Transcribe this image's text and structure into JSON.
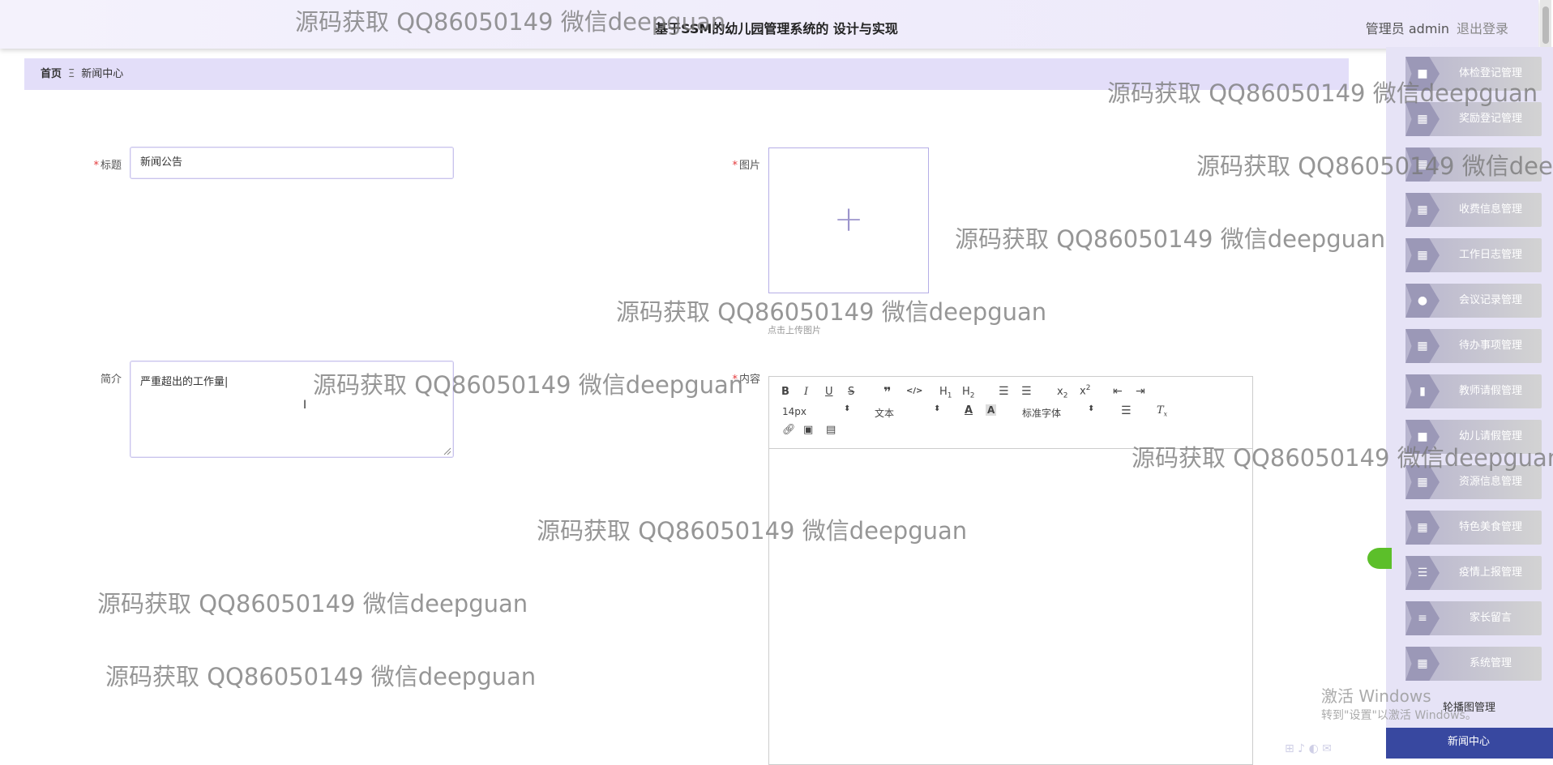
{
  "header": {
    "title": "基于SSM的幼儿园管理系统的 设计与实现",
    "user_label": "管理员 admin",
    "logout_label": "退出登录"
  },
  "breadcrumb": {
    "home": "首页",
    "separator": "Ξ",
    "current": "新闻中心"
  },
  "form": {
    "title_label": "标题",
    "title_value": "新闻公告",
    "image_label": "图片",
    "upload_hint": "点击上传图片",
    "summary_label": "简介",
    "summary_value": "严重超出的工作量|",
    "content_label": "内容"
  },
  "editor": {
    "font_size": "14px",
    "paragraph": "文本",
    "font_family": "标准字体"
  },
  "sidebar": {
    "items": [
      {
        "label": "体检登记管理",
        "icon": "briefcase-icon"
      },
      {
        "label": "奖励登记管理",
        "icon": "grid-icon"
      },
      {
        "label": "",
        "icon": "grid-icon"
      },
      {
        "label": "收费信息管理",
        "icon": "grid-icon"
      },
      {
        "label": "工作日志管理",
        "icon": "grid-icon"
      },
      {
        "label": "会议记录管理",
        "icon": "person-icon"
      },
      {
        "label": "待办事项管理",
        "icon": "grid-icon"
      },
      {
        "label": "教师请假管理",
        "icon": "bar-chart-icon"
      },
      {
        "label": "幼儿请假管理",
        "icon": "briefcase-icon"
      },
      {
        "label": "资源信息管理",
        "icon": "grid-icon"
      },
      {
        "label": "特色美食管理",
        "icon": "grid-icon"
      },
      {
        "label": "疫情上报管理",
        "icon": "list-icon"
      },
      {
        "label": "家长留言",
        "icon": "sliders-icon"
      },
      {
        "label": "系统管理",
        "icon": "grid-icon"
      }
    ],
    "carousel_label": "轮播图管理",
    "active_label": "新闻中心"
  },
  "watermark": {
    "text": "源码获取 QQ86050149 微信deepguan"
  },
  "windows_activation": {
    "title": "激活 Windows",
    "subtitle": "转到\"设置\"以激活 Windows。"
  },
  "colors": {
    "breadcrumb_bg": "#e3def9",
    "sidebar_active": "#3848a0",
    "required": "#e4393c"
  }
}
